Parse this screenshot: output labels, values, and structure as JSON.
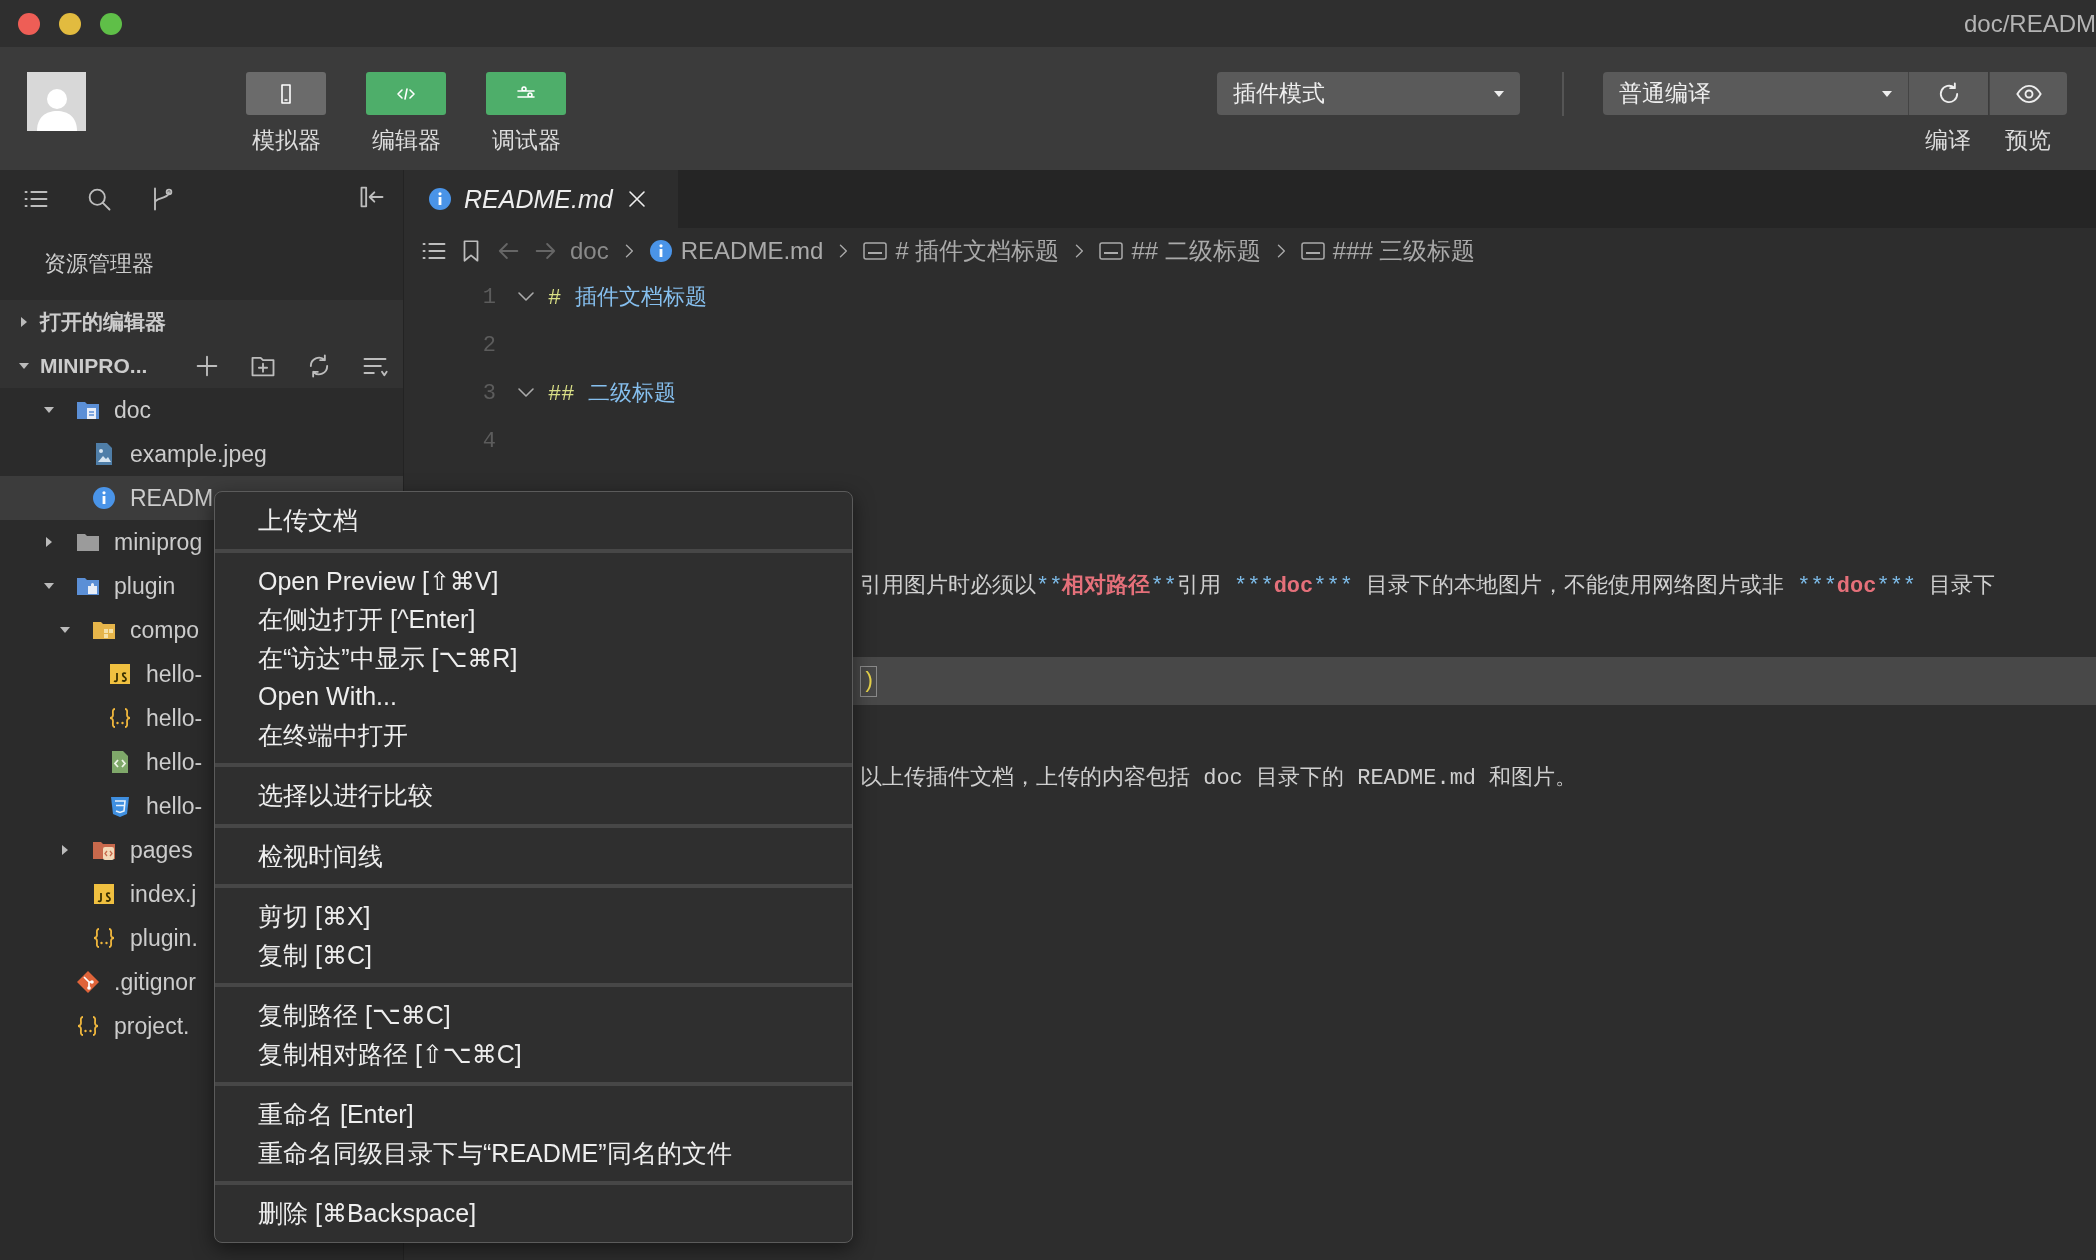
{
  "title_bar": {
    "title": "doc/READM"
  },
  "toolbar": {
    "mode_buttons": [
      {
        "kind": "phone",
        "label": "模拟器",
        "on": false
      },
      {
        "kind": "code",
        "label": "编辑器",
        "on": true
      },
      {
        "kind": "sliders",
        "label": "调试器",
        "on": true
      }
    ],
    "mode_select": "插件模式",
    "compile_select": "普通编译",
    "actions": [
      {
        "kind": "refresh",
        "label": "编译"
      },
      {
        "kind": "eye",
        "label": "预览"
      }
    ]
  },
  "sidebar": {
    "title": "资源管理器",
    "sections": [
      {
        "label": "打开的编辑器",
        "expanded": false
      },
      {
        "label": "MINIPRO...",
        "expanded": true
      }
    ],
    "tree": [
      {
        "label": "doc",
        "kind": "docs-folder",
        "expanded": true,
        "selected": false,
        "children": [
          {
            "label": "example.jpeg",
            "kind": "image",
            "selected": false
          },
          {
            "label": "READM",
            "kind": "info",
            "selected": true
          }
        ]
      },
      {
        "label": "miniprog",
        "kind": "folder",
        "expanded": false,
        "selected": false
      },
      {
        "label": "plugin",
        "kind": "plugin-folder",
        "expanded": true,
        "selected": false,
        "children": [
          {
            "label": "compo",
            "kind": "component-folder",
            "expanded": true,
            "selected": false,
            "children": [
              {
                "label": "hello-",
                "kind": "js",
                "selected": false
              },
              {
                "label": "hello-",
                "kind": "json",
                "selected": false
              },
              {
                "label": "hello-",
                "kind": "markup",
                "selected": false
              },
              {
                "label": "hello-",
                "kind": "css",
                "selected": false
              }
            ]
          },
          {
            "label": "pages",
            "kind": "pages-folder",
            "expanded": false,
            "selected": false
          },
          {
            "label": "index.j",
            "kind": "js",
            "selected": false
          },
          {
            "label": "plugin.",
            "kind": "json",
            "selected": false
          }
        ]
      },
      {
        "label": ".gitignor",
        "kind": "git",
        "selected": false
      },
      {
        "label": "project.",
        "kind": "json",
        "selected": false
      }
    ]
  },
  "editor": {
    "tab": {
      "label": "README.md",
      "selected": true
    },
    "breadcrumb": [
      {
        "kind": "folder",
        "text": "doc"
      },
      {
        "kind": "file",
        "text": "README.md"
      },
      {
        "kind": "symbol",
        "text": "# 插件文档标题"
      },
      {
        "kind": "symbol",
        "text": "## 二级标题"
      },
      {
        "kind": "symbol",
        "text": "### 三级标题"
      }
    ],
    "lines": [
      {
        "kind": "full",
        "number": "1",
        "foldable": true,
        "current": false,
        "segments": [
          {
            "kind": "mark",
            "text": "#"
          },
          {
            "kind": "heading",
            "text": "插件文档标题"
          }
        ]
      },
      {
        "kind": "full",
        "number": "2",
        "foldable": false,
        "current": false
      },
      {
        "kind": "full",
        "number": "3",
        "foldable": true,
        "current": false,
        "segments": [
          {
            "kind": "mark",
            "text": "##"
          },
          {
            "kind": "heading",
            "text": "二级标题"
          }
        ]
      },
      {
        "kind": "full",
        "number": "4",
        "foldable": false,
        "current": false
      },
      {
        "kind": "clipped",
        "current": false
      },
      {
        "kind": "clipped",
        "current": false
      },
      {
        "kind": "clipped",
        "current": false,
        "segments": [
          {
            "kind": "plain",
            "text": "引用图片时必须以"
          },
          {
            "kind": "marker",
            "text": "**"
          },
          {
            "kind": "strong",
            "text": "相对路径"
          },
          {
            "kind": "marker",
            "text": "**"
          },
          {
            "kind": "plain",
            "text": "引用 "
          },
          {
            "kind": "marker",
            "text": "***"
          },
          {
            "kind": "strong",
            "text": "doc"
          },
          {
            "kind": "marker",
            "text": "***"
          },
          {
            "kind": "plain",
            "text": " 目录下的本地图片，不能使用网络图片或非 "
          },
          {
            "kind": "marker",
            "text": "***"
          },
          {
            "kind": "strong",
            "text": "doc"
          },
          {
            "kind": "marker",
            "text": "***"
          },
          {
            "kind": "plain",
            "text": " 目录下"
          }
        ]
      },
      {
        "kind": "clipped",
        "current": false
      },
      {
        "kind": "clipped",
        "current": true,
        "segments": [
          {
            "kind": "bracket",
            "text": ")"
          }
        ]
      },
      {
        "kind": "clipped",
        "current": false
      },
      {
        "kind": "clipped",
        "current": false,
        "segments": [
          {
            "kind": "plain",
            "text": "以上传插件文档，上传的内容包括 doc 目录下的 README.md 和图片。"
          }
        ]
      }
    ]
  },
  "context_menu": {
    "sections": [
      {
        "items": [
          "上传文档"
        ]
      },
      {
        "items": [
          "Open Preview [⇧⌘V]",
          "在侧边打开 [^Enter]",
          "在“访达”中显示 [⌥⌘R]",
          "Open With...",
          "在终端中打开"
        ]
      },
      {
        "items": [
          "选择以进行比较"
        ]
      },
      {
        "items": [
          "检视时间线"
        ]
      },
      {
        "items": [
          "剪切 [⌘X]",
          "复制 [⌘C]"
        ]
      },
      {
        "items": [
          "复制路径 [⌥⌘C]",
          "复制相对路径 [⇧⌥⌘C]"
        ]
      },
      {
        "items": [
          "重命名 [Enter]",
          "重命名同级目录下与“README”同名的文件"
        ]
      },
      {
        "items": [
          "删除 [⌘Backspace]"
        ]
      }
    ]
  }
}
